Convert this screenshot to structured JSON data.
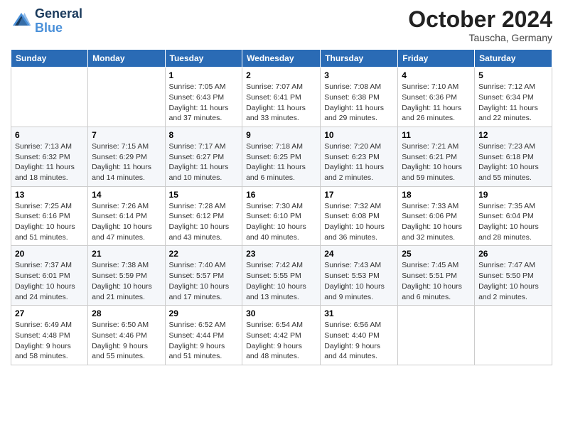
{
  "logo": {
    "line1": "General",
    "line2": "Blue"
  },
  "header": {
    "title": "October 2024",
    "location": "Tauscha, Germany"
  },
  "weekdays": [
    "Sunday",
    "Monday",
    "Tuesday",
    "Wednesday",
    "Thursday",
    "Friday",
    "Saturday"
  ],
  "weeks": [
    [
      {
        "day": "",
        "info": ""
      },
      {
        "day": "",
        "info": ""
      },
      {
        "day": "1",
        "info": "Sunrise: 7:05 AM\nSunset: 6:43 PM\nDaylight: 11 hours and 37 minutes."
      },
      {
        "day": "2",
        "info": "Sunrise: 7:07 AM\nSunset: 6:41 PM\nDaylight: 11 hours and 33 minutes."
      },
      {
        "day": "3",
        "info": "Sunrise: 7:08 AM\nSunset: 6:38 PM\nDaylight: 11 hours and 29 minutes."
      },
      {
        "day": "4",
        "info": "Sunrise: 7:10 AM\nSunset: 6:36 PM\nDaylight: 11 hours and 26 minutes."
      },
      {
        "day": "5",
        "info": "Sunrise: 7:12 AM\nSunset: 6:34 PM\nDaylight: 11 hours and 22 minutes."
      }
    ],
    [
      {
        "day": "6",
        "info": "Sunrise: 7:13 AM\nSunset: 6:32 PM\nDaylight: 11 hours and 18 minutes."
      },
      {
        "day": "7",
        "info": "Sunrise: 7:15 AM\nSunset: 6:29 PM\nDaylight: 11 hours and 14 minutes."
      },
      {
        "day": "8",
        "info": "Sunrise: 7:17 AM\nSunset: 6:27 PM\nDaylight: 11 hours and 10 minutes."
      },
      {
        "day": "9",
        "info": "Sunrise: 7:18 AM\nSunset: 6:25 PM\nDaylight: 11 hours and 6 minutes."
      },
      {
        "day": "10",
        "info": "Sunrise: 7:20 AM\nSunset: 6:23 PM\nDaylight: 11 hours and 2 minutes."
      },
      {
        "day": "11",
        "info": "Sunrise: 7:21 AM\nSunset: 6:21 PM\nDaylight: 10 hours and 59 minutes."
      },
      {
        "day": "12",
        "info": "Sunrise: 7:23 AM\nSunset: 6:18 PM\nDaylight: 10 hours and 55 minutes."
      }
    ],
    [
      {
        "day": "13",
        "info": "Sunrise: 7:25 AM\nSunset: 6:16 PM\nDaylight: 10 hours and 51 minutes."
      },
      {
        "day": "14",
        "info": "Sunrise: 7:26 AM\nSunset: 6:14 PM\nDaylight: 10 hours and 47 minutes."
      },
      {
        "day": "15",
        "info": "Sunrise: 7:28 AM\nSunset: 6:12 PM\nDaylight: 10 hours and 43 minutes."
      },
      {
        "day": "16",
        "info": "Sunrise: 7:30 AM\nSunset: 6:10 PM\nDaylight: 10 hours and 40 minutes."
      },
      {
        "day": "17",
        "info": "Sunrise: 7:32 AM\nSunset: 6:08 PM\nDaylight: 10 hours and 36 minutes."
      },
      {
        "day": "18",
        "info": "Sunrise: 7:33 AM\nSunset: 6:06 PM\nDaylight: 10 hours and 32 minutes."
      },
      {
        "day": "19",
        "info": "Sunrise: 7:35 AM\nSunset: 6:04 PM\nDaylight: 10 hours and 28 minutes."
      }
    ],
    [
      {
        "day": "20",
        "info": "Sunrise: 7:37 AM\nSunset: 6:01 PM\nDaylight: 10 hours and 24 minutes."
      },
      {
        "day": "21",
        "info": "Sunrise: 7:38 AM\nSunset: 5:59 PM\nDaylight: 10 hours and 21 minutes."
      },
      {
        "day": "22",
        "info": "Sunrise: 7:40 AM\nSunset: 5:57 PM\nDaylight: 10 hours and 17 minutes."
      },
      {
        "day": "23",
        "info": "Sunrise: 7:42 AM\nSunset: 5:55 PM\nDaylight: 10 hours and 13 minutes."
      },
      {
        "day": "24",
        "info": "Sunrise: 7:43 AM\nSunset: 5:53 PM\nDaylight: 10 hours and 9 minutes."
      },
      {
        "day": "25",
        "info": "Sunrise: 7:45 AM\nSunset: 5:51 PM\nDaylight: 10 hours and 6 minutes."
      },
      {
        "day": "26",
        "info": "Sunrise: 7:47 AM\nSunset: 5:50 PM\nDaylight: 10 hours and 2 minutes."
      }
    ],
    [
      {
        "day": "27",
        "info": "Sunrise: 6:49 AM\nSunset: 4:48 PM\nDaylight: 9 hours and 58 minutes."
      },
      {
        "day": "28",
        "info": "Sunrise: 6:50 AM\nSunset: 4:46 PM\nDaylight: 9 hours and 55 minutes."
      },
      {
        "day": "29",
        "info": "Sunrise: 6:52 AM\nSunset: 4:44 PM\nDaylight: 9 hours and 51 minutes."
      },
      {
        "day": "30",
        "info": "Sunrise: 6:54 AM\nSunset: 4:42 PM\nDaylight: 9 hours and 48 minutes."
      },
      {
        "day": "31",
        "info": "Sunrise: 6:56 AM\nSunset: 4:40 PM\nDaylight: 9 hours and 44 minutes."
      },
      {
        "day": "",
        "info": ""
      },
      {
        "day": "",
        "info": ""
      }
    ]
  ]
}
